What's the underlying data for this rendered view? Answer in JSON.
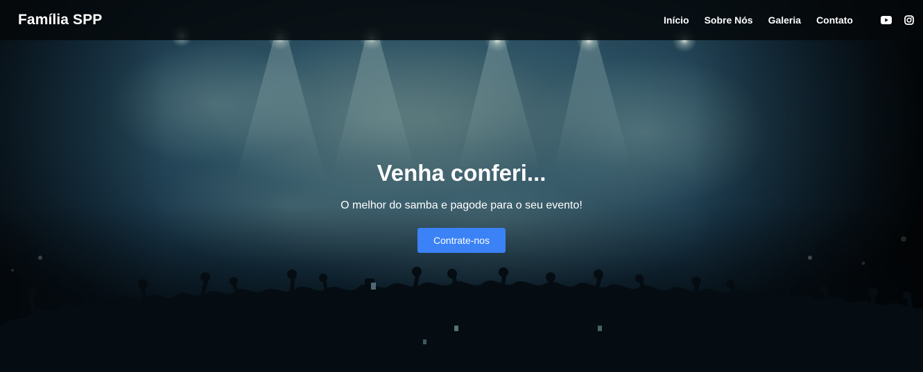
{
  "navbar": {
    "brand": "Família SPP",
    "links": [
      {
        "label": "Início"
      },
      {
        "label": "Sobre Nós"
      },
      {
        "label": "Galeria"
      },
      {
        "label": "Contato"
      }
    ],
    "social": [
      {
        "icon": "youtube-icon"
      },
      {
        "icon": "instagram-icon"
      }
    ]
  },
  "hero": {
    "title": "Venha conferi...",
    "subtitle": "O melhor do samba e pagode para o seu evento!",
    "cta_label": "Contrate-nos",
    "background": "concert-crowd-stage-image"
  },
  "colors": {
    "navbar_bg": "#05080a",
    "accent": "#3b82f6",
    "text": "#ffffff",
    "hero_tint": "#1f4a5c"
  }
}
